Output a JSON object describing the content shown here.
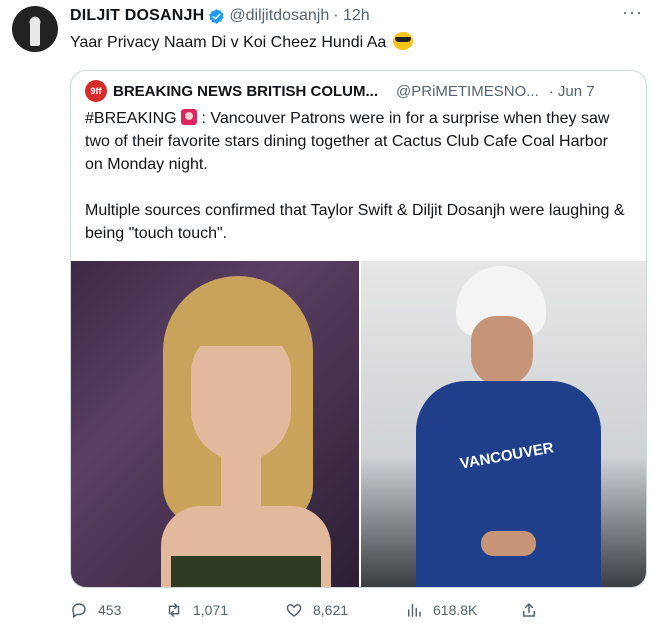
{
  "post": {
    "author_name": "DILJIT DOSANJH",
    "handle": "@diljitdosanjh",
    "time": "· 12h",
    "text": "Yaar Privacy Naam Di v Koi Cheez Hundi Aa",
    "emoji": "smiling-face-with-sunglasses"
  },
  "quoted": {
    "logo_text": "9ff",
    "author_name": "BREAKING NEWS BRITISH COLUM...",
    "handle": "@PRiMETIMESNO...",
    "date": "· Jun 7",
    "line1_prefix": "#BREAKING",
    "line1_rest": ":  Vancouver Patrons were in for a surprise when they saw two of their favorite stars dining together at  Cactus Club Cafe Coal Harbor on Monday night.",
    "line2": "Multiple sources confirmed that Taylor Swift & Diljit Dosanjh were laughing & being \"touch touch\"."
  },
  "actions": {
    "replies": "453",
    "reposts": "1,071",
    "likes": "8,621",
    "views": "618.8K"
  },
  "colors": {
    "text": "#0f1419",
    "muted": "#536471",
    "verified": "#1d9bf0",
    "border": "#cfd9de"
  }
}
